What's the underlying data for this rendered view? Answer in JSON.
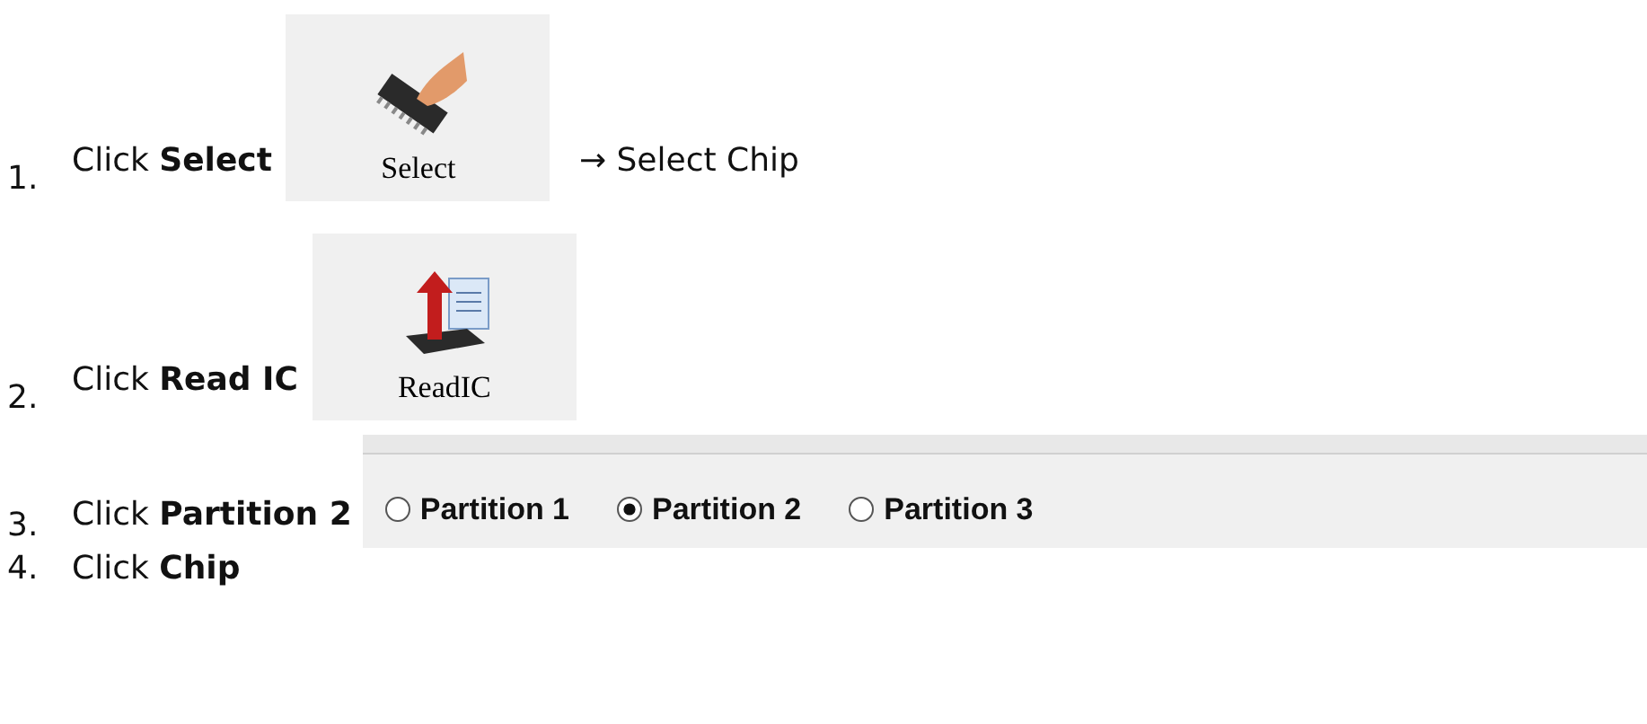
{
  "steps": [
    {
      "number": "1.",
      "text": "Click **Select**",
      "attachment": {
        "kind": "tool_button",
        "label": "Select"
      },
      "after": "→ Select Chip"
    },
    {
      "number": "2.",
      "text": "Click **Read IC**",
      "attachment": {
        "kind": "tool_button",
        "label": "ReadIC"
      }
    },
    {
      "number": "3.",
      "text": "Click **Partition 2**",
      "attachment": {
        "kind": "radio_group",
        "options": [
          {
            "label": "Partition 1",
            "selected": false
          },
          {
            "label": "Partition 2",
            "selected": true
          },
          {
            "label": "Partition 3",
            "selected": false
          }
        ]
      }
    },
    {
      "number": "4.",
      "text": "Click **Chip**"
    }
  ]
}
